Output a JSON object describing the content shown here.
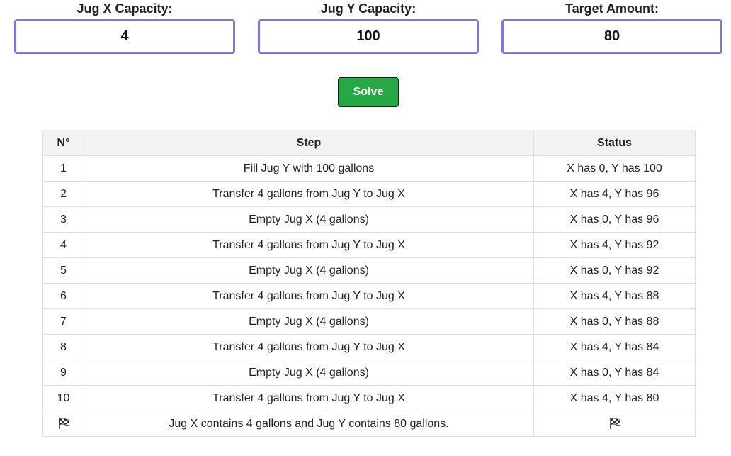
{
  "form": {
    "jug_x": {
      "label": "Jug X Capacity:",
      "value": "4"
    },
    "jug_y": {
      "label": "Jug Y Capacity:",
      "value": "100"
    },
    "target": {
      "label": "Target Amount:",
      "value": "80"
    },
    "solve_label": "Solve"
  },
  "table": {
    "headers": {
      "num": "N°",
      "step": "Step",
      "status": "Status"
    },
    "rows": [
      {
        "num": "1",
        "step": "Fill Jug Y with 100 gallons",
        "status": "X has 0, Y has 100"
      },
      {
        "num": "2",
        "step": "Transfer 4 gallons from Jug Y to Jug X",
        "status": "X has 4, Y has 96"
      },
      {
        "num": "3",
        "step": "Empty Jug X (4 gallons)",
        "status": "X has 0, Y has 96"
      },
      {
        "num": "4",
        "step": "Transfer 4 gallons from Jug Y to Jug X",
        "status": "X has 4, Y has 92"
      },
      {
        "num": "5",
        "step": "Empty Jug X (4 gallons)",
        "status": "X has 0, Y has 92"
      },
      {
        "num": "6",
        "step": "Transfer 4 gallons from Jug Y to Jug X",
        "status": "X has 4, Y has 88"
      },
      {
        "num": "7",
        "step": "Empty Jug X (4 gallons)",
        "status": "X has 0, Y has 88"
      },
      {
        "num": "8",
        "step": "Transfer 4 gallons from Jug Y to Jug X",
        "status": "X has 4, Y has 84"
      },
      {
        "num": "9",
        "step": "Empty Jug X (4 gallons)",
        "status": "X has 0, Y has 84"
      },
      {
        "num": "10",
        "step": "Transfer 4 gallons from Jug Y to Jug X",
        "status": "X has 4, Y has 80"
      }
    ],
    "final": {
      "num_icon": "checkered-flag-icon",
      "step": "Jug X contains 4 gallons and Jug Y contains 80 gallons.",
      "status_icon": "checkered-flag-icon"
    }
  },
  "colors": {
    "input_border": "#7b78e0",
    "button_bg": "#28a745",
    "header_bg": "#f2f2f2"
  }
}
